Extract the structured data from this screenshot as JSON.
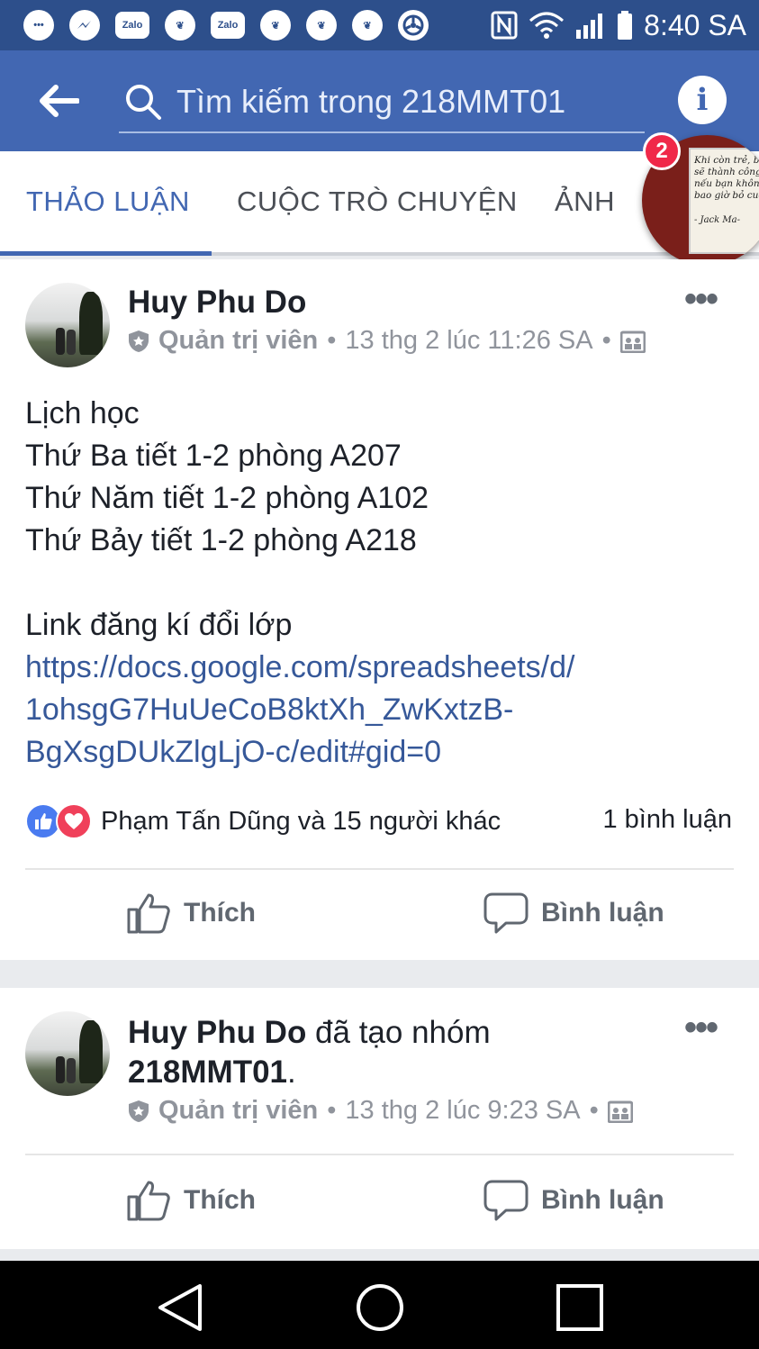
{
  "status_bar": {
    "left_icons": [
      "chat-icon",
      "messenger-icon",
      "zalo-icon",
      "uc-browser-icon",
      "zalo-icon",
      "uc-browser-icon",
      "uc-browser-icon",
      "uc-browser-icon",
      "steering-icon"
    ],
    "zalo_label": "Zalo",
    "time": "8:40 SA"
  },
  "search": {
    "placeholder": "Tìm kiếm trong 218MMT01"
  },
  "tabs": [
    {
      "label": "THẢO LUẬN",
      "active": true
    },
    {
      "label": "CUỘC TRÒ CHUYỆN",
      "active": false
    },
    {
      "label": "ẢNH",
      "active": false
    }
  ],
  "chat_head": {
    "badge": "2",
    "quote_lines": [
      "Khi còn trẻ, bạn",
      "sẽ thành công",
      "nếu bạn không",
      "bao giờ bỏ cuộc"
    ],
    "quote_author": "- Jack Ma-"
  },
  "posts": [
    {
      "author": "Huy Phu Do",
      "role": "Quản trị viên",
      "timestamp": "13 thg 2 lúc 11:26 SA",
      "body_lines": [
        "Lịch học",
        "Thứ Ba tiết 1-2 phòng A207",
        "Thứ Năm tiết 1-2 phòng A102",
        "Thứ Bảy tiết 1-2 phòng A218",
        "",
        "Link đăng kí đổi lớp"
      ],
      "link_lines": [
        "https://docs.google.com/spreadsheets/d/",
        "1ohsgG7HuUeCoB8ktXh_ZwKxtzB-",
        "BgXsgDUkZlgLjO-c/edit#gid=0"
      ],
      "reactions_text": "Phạm Tấn Dũng và 15 người khác",
      "comments_text": "1 bình luận",
      "like_label": "Thích",
      "comment_label": "Bình luận"
    },
    {
      "author": "Huy Phu Do",
      "action_text": " đã tạo nhóm",
      "group_name": "218MMT01",
      "period": ".",
      "role": "Quản trị viên",
      "timestamp": "13 thg 2 lúc 9:23 SA",
      "like_label": "Thích",
      "comment_label": "Bình luận"
    }
  ],
  "colors": {
    "status_bar": "#2d4f8b",
    "header": "#4267b2",
    "link": "#365899",
    "active_tab": "#4267b2"
  }
}
